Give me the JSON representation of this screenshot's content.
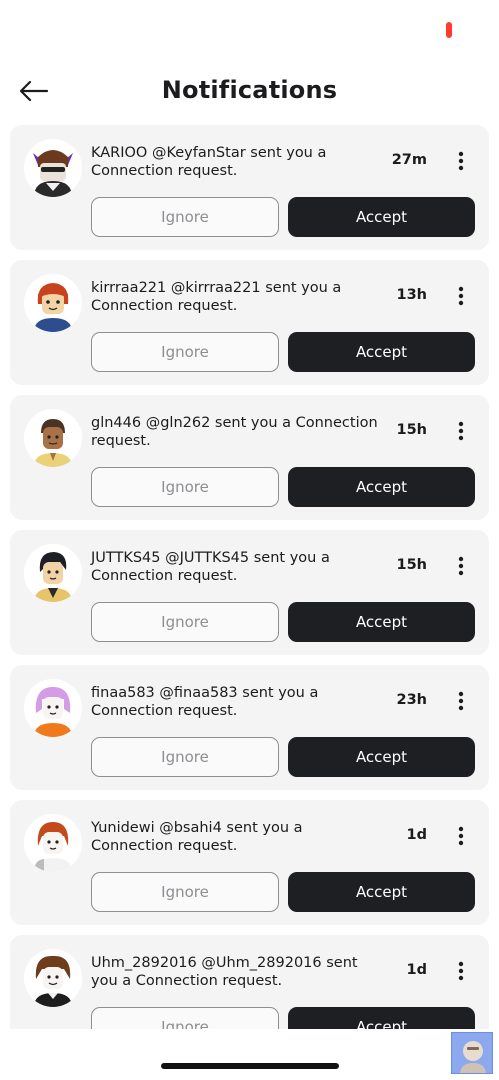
{
  "header": {
    "title": "Notifications"
  },
  "actions": {
    "ignore_label": "Ignore",
    "accept_label": "Accept"
  },
  "notifications": [
    {
      "text": "KARIOO @KeyfanStar sent you a Connection request.",
      "time": "27m"
    },
    {
      "text": "kirrraa221 @kirrraa221 sent you a Connection request.",
      "time": "13h"
    },
    {
      "text": "gln446 @gln262 sent you a Connection request.",
      "time": "15h"
    },
    {
      "text": "JUTTKS45 @JUTTKS45 sent you a Connection request.",
      "time": "15h"
    },
    {
      "text": "finaa583 @finaa583 sent you a Connection request.",
      "time": "23h"
    },
    {
      "text": "Yunidewi @bsahi4 sent you a Connection request.",
      "time": "1d"
    },
    {
      "text": "Uhm_2892016 @Uhm_2892016 sent you a Connection request.",
      "time": "1d"
    }
  ]
}
